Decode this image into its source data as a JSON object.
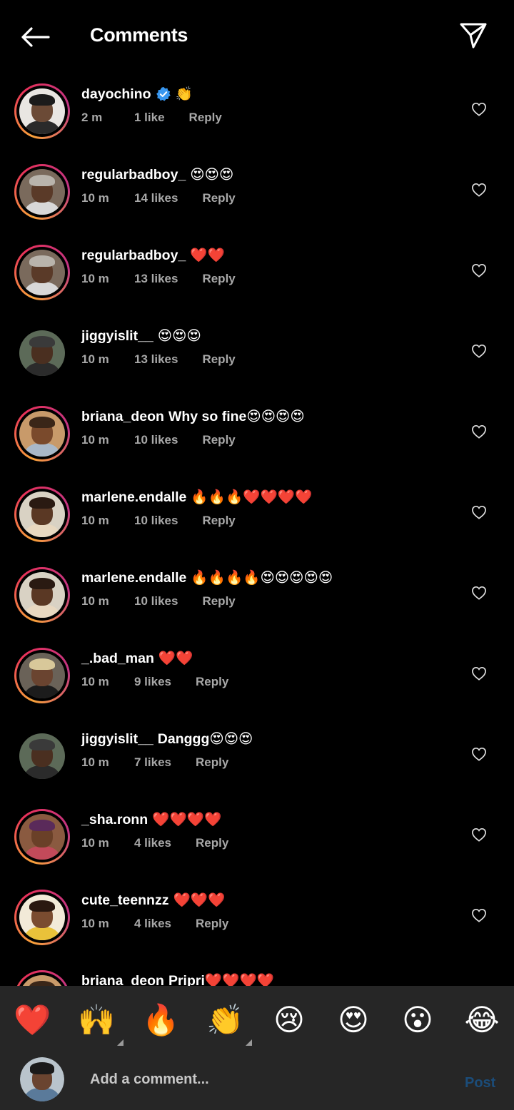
{
  "header": {
    "title": "Comments",
    "back_icon": "arrow-left-icon",
    "share_icon": "paper-plane-icon"
  },
  "comments": [
    {
      "username": "dayochino",
      "verified": true,
      "text": "👏",
      "time": "2 m",
      "likes": "1 like",
      "reply": "Reply"
    },
    {
      "username": "regularbadboy_",
      "text": "😍😍😍",
      "time": "10 m",
      "likes": "14 likes",
      "reply": "Reply"
    },
    {
      "username": "regularbadboy_",
      "text": "❤️❤️",
      "time": "10 m",
      "likes": "13 likes",
      "reply": "Reply"
    },
    {
      "username": "jiggyislit__",
      "text": "😍😍😍",
      "time": "10 m",
      "likes": "13 likes",
      "reply": "Reply"
    },
    {
      "username": "briana_deon",
      "text": "Why so fine😍😍😍😍",
      "time": "10 m",
      "likes": "10 likes",
      "reply": "Reply"
    },
    {
      "username": "marlene.endalle",
      "text": "🔥🔥🔥❤️❤️❤️❤️",
      "time": "10 m",
      "likes": "10 likes",
      "reply": "Reply"
    },
    {
      "username": "marlene.endalle",
      "text": "🔥🔥🔥🔥😍😍😍😍😍",
      "time": "10 m",
      "likes": "10 likes",
      "reply": "Reply"
    },
    {
      "username": "_.bad_man",
      "text": "❤️❤️",
      "time": "10 m",
      "likes": "9 likes",
      "reply": "Reply"
    },
    {
      "username": "jiggyislit__",
      "text": "Danggg😍😍😍",
      "time": "10 m",
      "likes": "7 likes",
      "reply": "Reply"
    },
    {
      "username": "_sha.ronn",
      "text": "❤️❤️❤️❤️",
      "time": "10 m",
      "likes": "4 likes",
      "reply": "Reply"
    },
    {
      "username": "cute_teennzz",
      "text": "❤️❤️❤️",
      "time": "10 m",
      "likes": "4 likes",
      "reply": "Reply"
    },
    {
      "username": "briana_deon",
      "text": "Pripri❤️❤️❤️❤️",
      "time": "",
      "likes": "",
      "reply": ""
    }
  ],
  "emoji_bar": [
    "❤️",
    "🙌",
    "🔥",
    "👏",
    "😢",
    "😍",
    "😮",
    "😂"
  ],
  "composer": {
    "placeholder": "Add a comment...",
    "post_label": "Post"
  },
  "colors": {
    "background": "#000000",
    "meta_text": "#a8a8a8",
    "bar_background": "#262626",
    "post_disabled": "#1b4c79",
    "verified_blue": "#3897f0"
  }
}
